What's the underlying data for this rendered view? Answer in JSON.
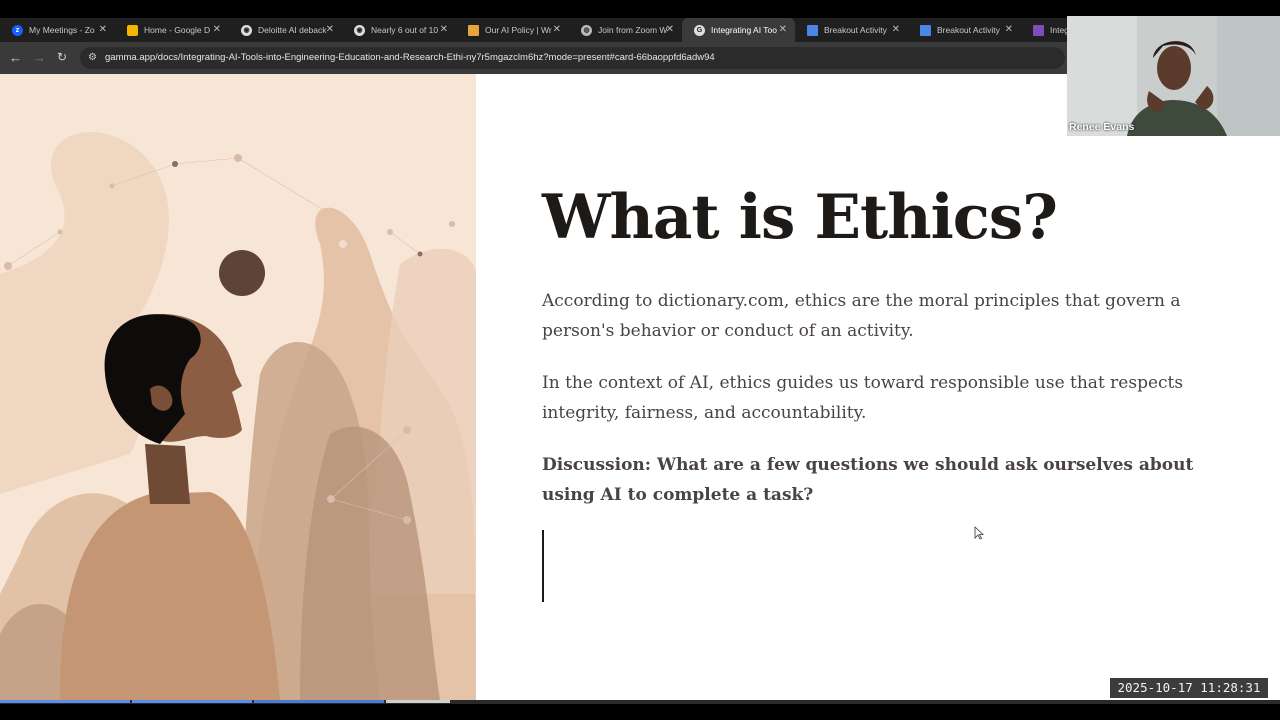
{
  "browser": {
    "tabs": [
      {
        "label": "My Meetings - Zo",
        "favicon": "zoom-icon",
        "color": "#1a5eff"
      },
      {
        "label": "Home - Google D",
        "favicon": "google-drive-icon",
        "color": "#f4b400"
      },
      {
        "label": "Deloitte AI deback",
        "favicon": "web-icon",
        "color": "#dddddd"
      },
      {
        "label": "Nearly 6 out of 10",
        "favicon": "web-icon",
        "color": "#dddddd"
      },
      {
        "label": "Our AI Policy | Wr",
        "favicon": "document-icon",
        "color": "#e8a33d"
      },
      {
        "label": "Join from Zoom W",
        "favicon": "globe-icon",
        "color": "#bbbbbb"
      },
      {
        "label": "Integrating AI Too",
        "favicon": "gamma-icon",
        "color": "#dddddd",
        "active": true
      },
      {
        "label": "Breakout Activity",
        "favicon": "google-docs-icon",
        "color": "#4a86e8"
      },
      {
        "label": "Breakout Activity",
        "favicon": "google-docs-icon",
        "color": "#4a86e8"
      },
      {
        "label": "Integra",
        "favicon": "forms-icon",
        "color": "#7c4dbd"
      }
    ],
    "url": "gamma.app/docs/Integrating-AI-Tools-into-Engineering-Education-and-Research-Ethi-ny7r5mgazclm6hz?mode=present#card-66baoppfd6adw94"
  },
  "slide": {
    "title": "What is Ethics?",
    "paragraph1": "According to dictionary.com, ethics are the moral principles that govern a person's behavior or conduct of an activity.",
    "paragraph2": " In the context of AI, ethics guides us toward responsible use that respects integrity, fairness, and accountability.",
    "discussion": "Discussion: What are a few questions we should ask ourselves about using AI to complete a task?"
  },
  "video": {
    "participant_name": "Renee Evans"
  },
  "recording": {
    "timestamp": "2025-10-17 11:28:31"
  },
  "colors": {
    "slide_bg": "#ffffff",
    "title": "#1d1a17",
    "body": "#4a4340",
    "art_bg": "#f7e6d6"
  }
}
